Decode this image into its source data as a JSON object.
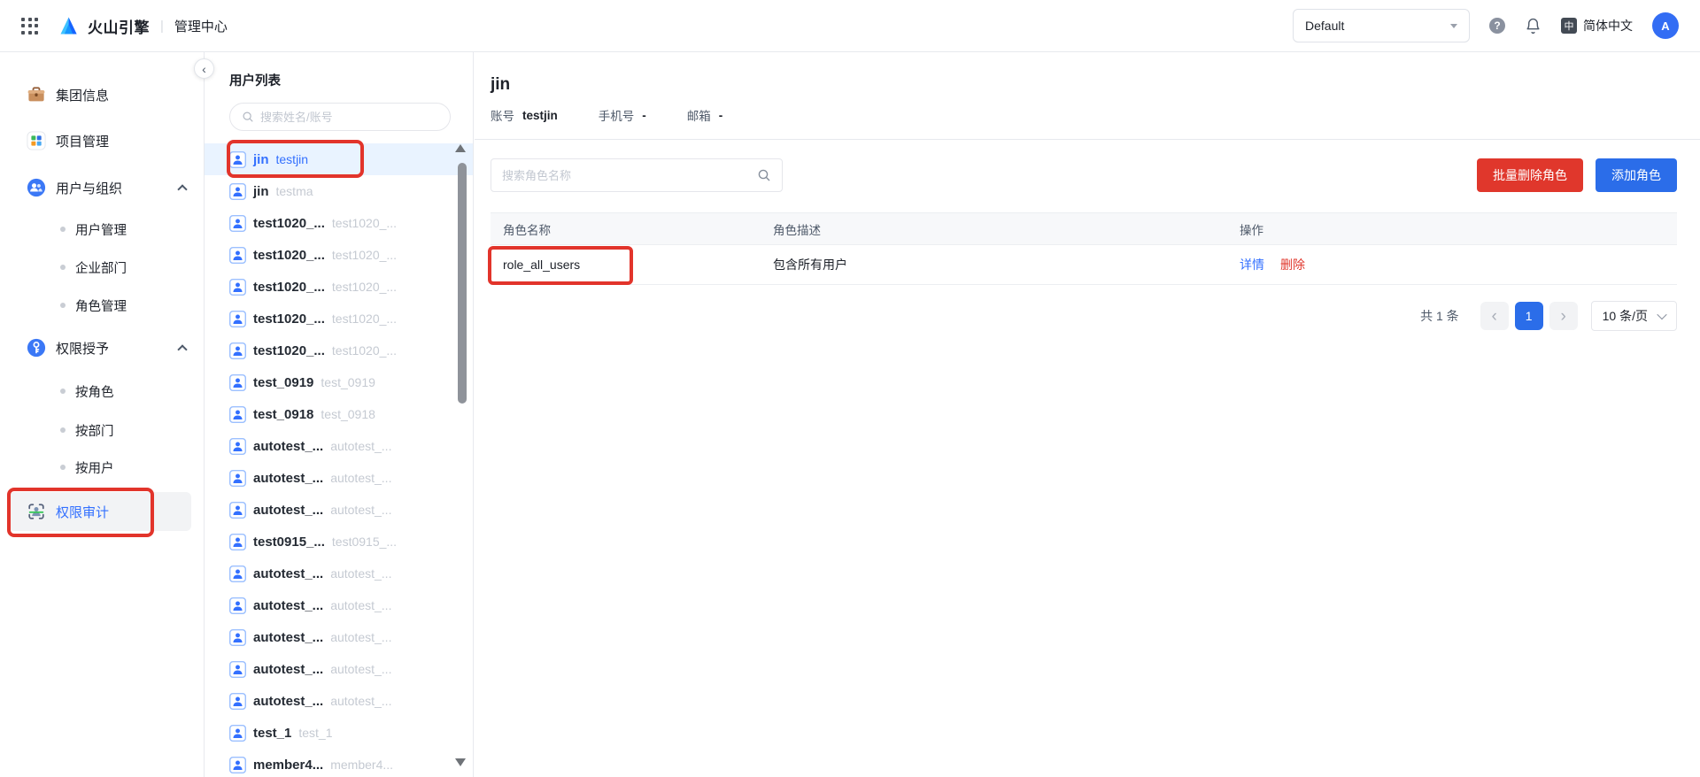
{
  "topbar": {
    "brand": "火山引擎",
    "app": "管理中心",
    "workspace": "Default",
    "language": "简体中文",
    "avatar_initial": "A"
  },
  "sidebar": {
    "items": [
      {
        "key": "group-info",
        "label": "集团信息",
        "icon": "briefcase-icon",
        "type": "top"
      },
      {
        "key": "project-mgmt",
        "label": "项目管理",
        "icon": "apps-grid-icon",
        "type": "top"
      },
      {
        "key": "users-org",
        "label": "用户与组织",
        "icon": "users-icon",
        "type": "top",
        "expanded": true
      },
      {
        "key": "user-mgmt",
        "label": "用户管理",
        "type": "sub"
      },
      {
        "key": "enterprise-dept",
        "label": "企业部门",
        "type": "sub"
      },
      {
        "key": "role-mgmt",
        "label": "角色管理",
        "type": "sub"
      },
      {
        "key": "perm-grant",
        "label": "权限授予",
        "icon": "key-icon",
        "type": "top",
        "expanded": true
      },
      {
        "key": "by-role",
        "label": "按角色",
        "type": "sub"
      },
      {
        "key": "by-dept",
        "label": "按部门",
        "type": "sub"
      },
      {
        "key": "by-user",
        "label": "按用户",
        "type": "sub"
      },
      {
        "key": "perm-audit",
        "label": "权限审计",
        "icon": "audit-scan-icon",
        "type": "top",
        "selected": true
      }
    ]
  },
  "user_panel": {
    "title": "用户列表",
    "search_placeholder": "搜索姓名/账号",
    "users": [
      {
        "name": "jin",
        "account": "testjin",
        "selected": true
      },
      {
        "name": "jin",
        "account": "testma"
      },
      {
        "name": "test1020_...",
        "account": "test1020_..."
      },
      {
        "name": "test1020_...",
        "account": "test1020_..."
      },
      {
        "name": "test1020_...",
        "account": "test1020_..."
      },
      {
        "name": "test1020_...",
        "account": "test1020_..."
      },
      {
        "name": "test1020_...",
        "account": "test1020_..."
      },
      {
        "name": "test_0919",
        "account": "test_0919"
      },
      {
        "name": "test_0918",
        "account": "test_0918"
      },
      {
        "name": "autotest_...",
        "account": "autotest_..."
      },
      {
        "name": "autotest_...",
        "account": "autotest_..."
      },
      {
        "name": "autotest_...",
        "account": "autotest_..."
      },
      {
        "name": "test0915_...",
        "account": "test0915_..."
      },
      {
        "name": "autotest_...",
        "account": "autotest_..."
      },
      {
        "name": "autotest_...",
        "account": "autotest_..."
      },
      {
        "name": "autotest_...",
        "account": "autotest_..."
      },
      {
        "name": "autotest_...",
        "account": "autotest_..."
      },
      {
        "name": "autotest_...",
        "account": "autotest_..."
      },
      {
        "name": "test_1",
        "account": "test_1"
      },
      {
        "name": "member4...",
        "account": "member4..."
      }
    ]
  },
  "main": {
    "title": "jin",
    "meta": [
      {
        "label": "账号",
        "value": "testjin"
      },
      {
        "label": "手机号",
        "value": "-"
      },
      {
        "label": "邮箱",
        "value": "-"
      }
    ],
    "role_search_placeholder": "搜索角色名称",
    "buttons": {
      "batch_delete": "批量删除角色",
      "add_role": "添加角色"
    },
    "table": {
      "columns": [
        "角色名称",
        "角色描述",
        "操作"
      ],
      "rows": [
        {
          "role_name": "role_all_users",
          "role_desc": "包含所有用户",
          "actions": [
            "详情",
            "删除"
          ]
        }
      ]
    },
    "pagination": {
      "total": "共 1 条",
      "current_page": "1",
      "page_size": "10 条/页"
    }
  },
  "annotations": {
    "color": "#e2342b",
    "boxes": [
      "sidebar-perm-audit",
      "user-jin-testjin",
      "role-name-cell"
    ]
  },
  "colors": {
    "primary_blue": "#2b6de9",
    "link_blue": "#3370ff",
    "danger_red": "#e0372c",
    "selected_row_bg": "#e9f3ff",
    "nav_selected_bg": "#f2f3f5",
    "table_header_bg": "#f7f8fa",
    "border": "#e7e9ee"
  }
}
